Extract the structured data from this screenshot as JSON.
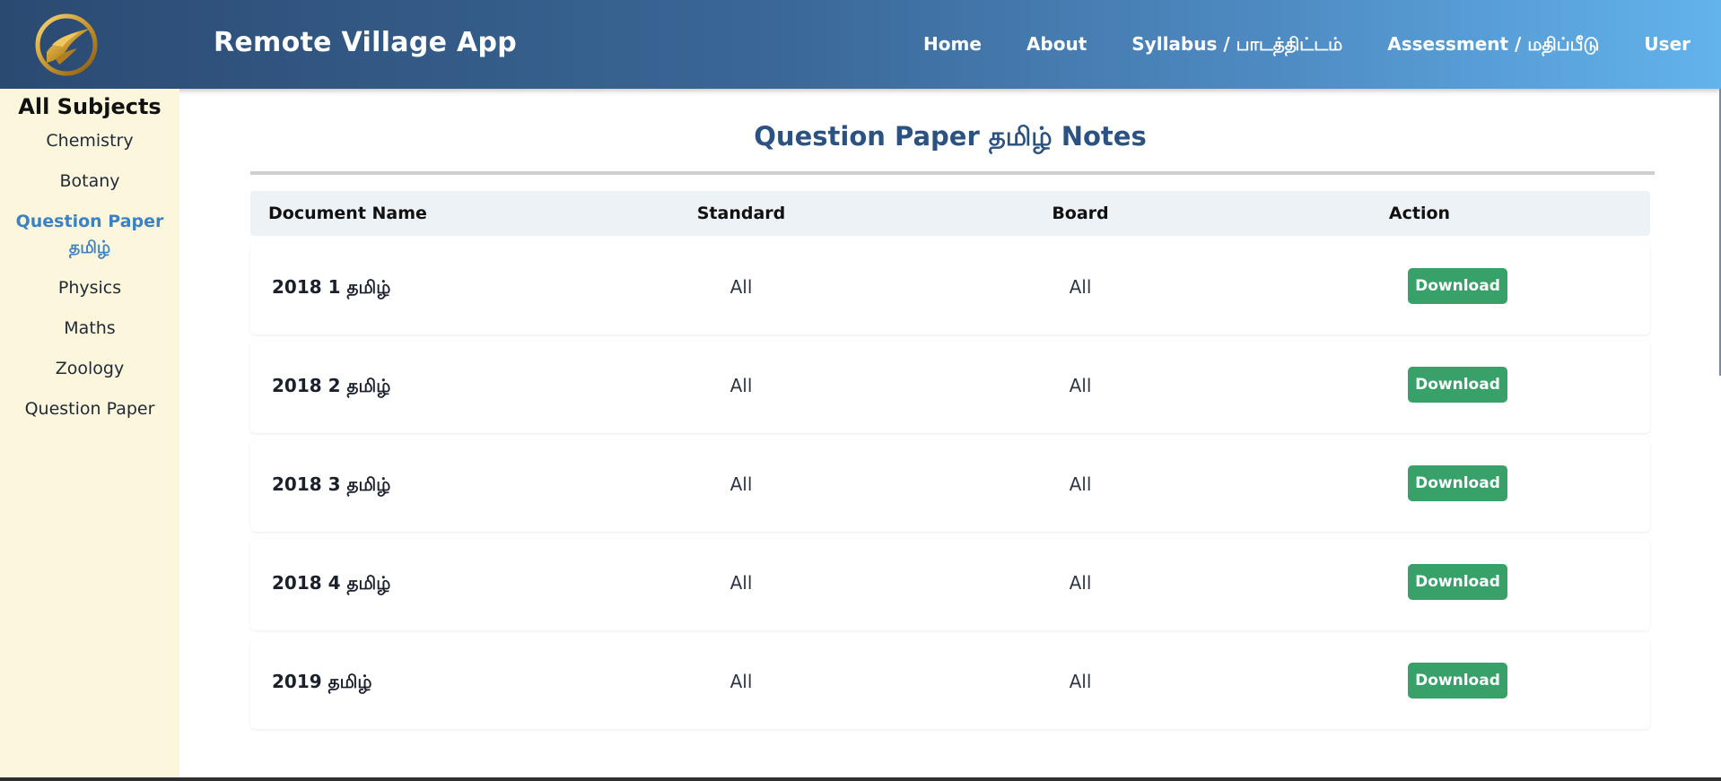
{
  "header": {
    "brand": "Remote Village App",
    "logo_icon": "golden-bird-logo",
    "nav": [
      {
        "label": "Home"
      },
      {
        "label": "About"
      },
      {
        "label": "Syllabus / பாடத்திட்டம்"
      },
      {
        "label": "Assessment / மதிப்பீடு"
      },
      {
        "label": "User"
      }
    ]
  },
  "sidebar": {
    "title": "All Subjects",
    "items": [
      {
        "label": "Chemistry",
        "active": false
      },
      {
        "label": "Botany",
        "active": false
      },
      {
        "label": "Question Paper தமிழ்",
        "active": true
      },
      {
        "label": "Physics",
        "active": false
      },
      {
        "label": "Maths",
        "active": false
      },
      {
        "label": "Zoology",
        "active": false
      },
      {
        "label": "Question Paper",
        "active": false
      }
    ]
  },
  "main": {
    "title": "Question Paper தமிழ் Notes",
    "columns": {
      "name": "Document Name",
      "standard": "Standard",
      "board": "Board",
      "action": "Action"
    },
    "rows": [
      {
        "name": "2018 1 தமிழ்",
        "standard": "All",
        "board": "All",
        "action": "Download"
      },
      {
        "name": "2018 2 தமிழ்",
        "standard": "All",
        "board": "All",
        "action": "Download"
      },
      {
        "name": "2018 3 தமிழ்",
        "standard": "All",
        "board": "All",
        "action": "Download"
      },
      {
        "name": "2018 4 தமிழ்",
        "standard": "All",
        "board": "All",
        "action": "Download"
      },
      {
        "name": "2019 தமிழ்",
        "standard": "All",
        "board": "All",
        "action": "Download"
      }
    ]
  },
  "colors": {
    "header_start": "#2b4a72",
    "header_end": "#63b3ec",
    "sidebar_bg": "#fcf7dc",
    "title": "#2c5282",
    "active_link": "#3b82c4",
    "download_button": "#38a169"
  }
}
